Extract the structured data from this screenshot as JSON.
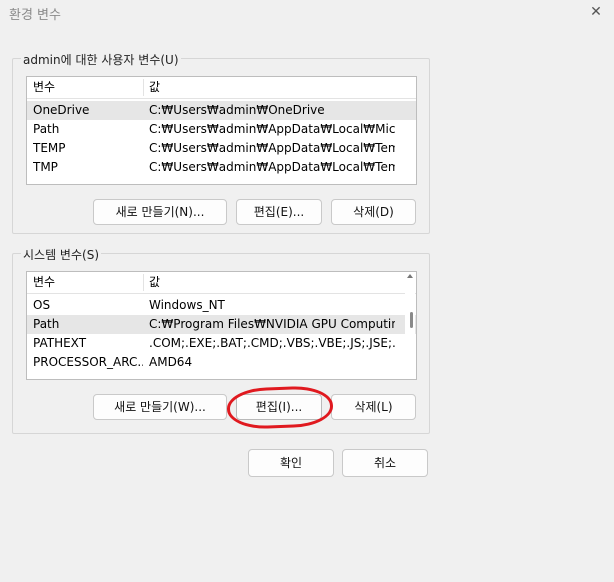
{
  "window": {
    "title": "환경 변수",
    "close_icon": "close-icon"
  },
  "user_vars": {
    "legend": "admin에 대한 사용자 변수(U)",
    "header": {
      "name": "변수",
      "value": "값"
    },
    "rows": [
      {
        "name": "OneDrive",
        "value": "C:₩Users₩admin₩OneDrive",
        "selected": true
      },
      {
        "name": "Path",
        "value": "C:₩Users₩admin₩AppData₩Local₩Micros..."
      },
      {
        "name": "TEMP",
        "value": "C:₩Users₩admin₩AppData₩Local₩Temp"
      },
      {
        "name": "TMP",
        "value": "C:₩Users₩admin₩AppData₩Local₩Temp"
      }
    ],
    "buttons": {
      "new": "새로 만들기(N)...",
      "edit": "편집(E)...",
      "delete": "삭제(D)"
    }
  },
  "system_vars": {
    "legend": "시스템 변수(S)",
    "header": {
      "name": "변수",
      "value": "값"
    },
    "rows": [
      {
        "name": "OS",
        "value": "Windows_NT"
      },
      {
        "name": "Path",
        "value": "C:₩Program Files₩NVIDIA GPU Computing...",
        "selected": true
      },
      {
        "name": "PATHEXT",
        "value": ".COM;.EXE;.BAT;.CMD;.VBS;.VBE;.JS;.JSE;.W..."
      },
      {
        "name": "PROCESSOR_ARC...",
        "value": "AMD64"
      }
    ],
    "buttons": {
      "new": "새로 만들기(W)...",
      "edit": "편집(I)...",
      "delete": "삭제(L)"
    }
  },
  "footer": {
    "ok": "확인",
    "cancel": "취소"
  },
  "colors": {
    "annotation": "#e0191f",
    "selected_row": "#e6e6e6",
    "background": "#f0f0f0"
  }
}
